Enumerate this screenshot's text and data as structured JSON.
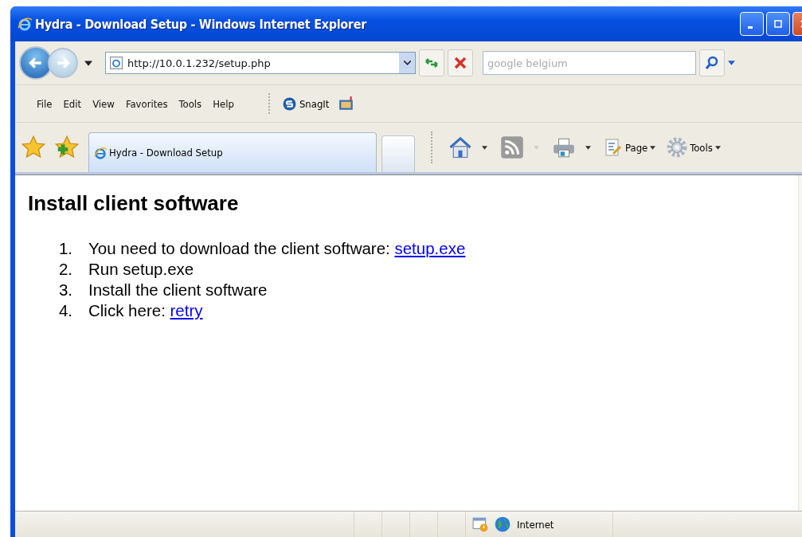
{
  "window": {
    "title": "Hydra - Download Setup - Windows Internet Explorer"
  },
  "address_bar": {
    "url": "http://10.0.1.232/setup.php"
  },
  "search": {
    "placeholder": "google belgium"
  },
  "menu": [
    "File",
    "Edit",
    "View",
    "Favorites",
    "Tools",
    "Help"
  ],
  "snagit": {
    "label": "SnagIt"
  },
  "tabs": [
    {
      "label": "Hydra - Download Setup",
      "selected": true
    }
  ],
  "command_bar": [
    {
      "kind": "home"
    },
    {
      "kind": "feed",
      "disabled": true
    },
    {
      "kind": "print"
    },
    {
      "kind": "page",
      "label": "Page"
    },
    {
      "kind": "tools",
      "label": "Tools"
    }
  ],
  "page": {
    "heading": "Install client software",
    "steps": [
      {
        "number": "1.",
        "text": "You need to download the client software: ",
        "link": "setup.exe"
      },
      {
        "number": "2.",
        "text": "Run setup.exe"
      },
      {
        "number": "3.",
        "text": "Install the client software"
      },
      {
        "number": "4.",
        "text": "Click here: ",
        "link": "retry"
      }
    ]
  },
  "status_bar": {
    "zone": "Internet"
  }
}
